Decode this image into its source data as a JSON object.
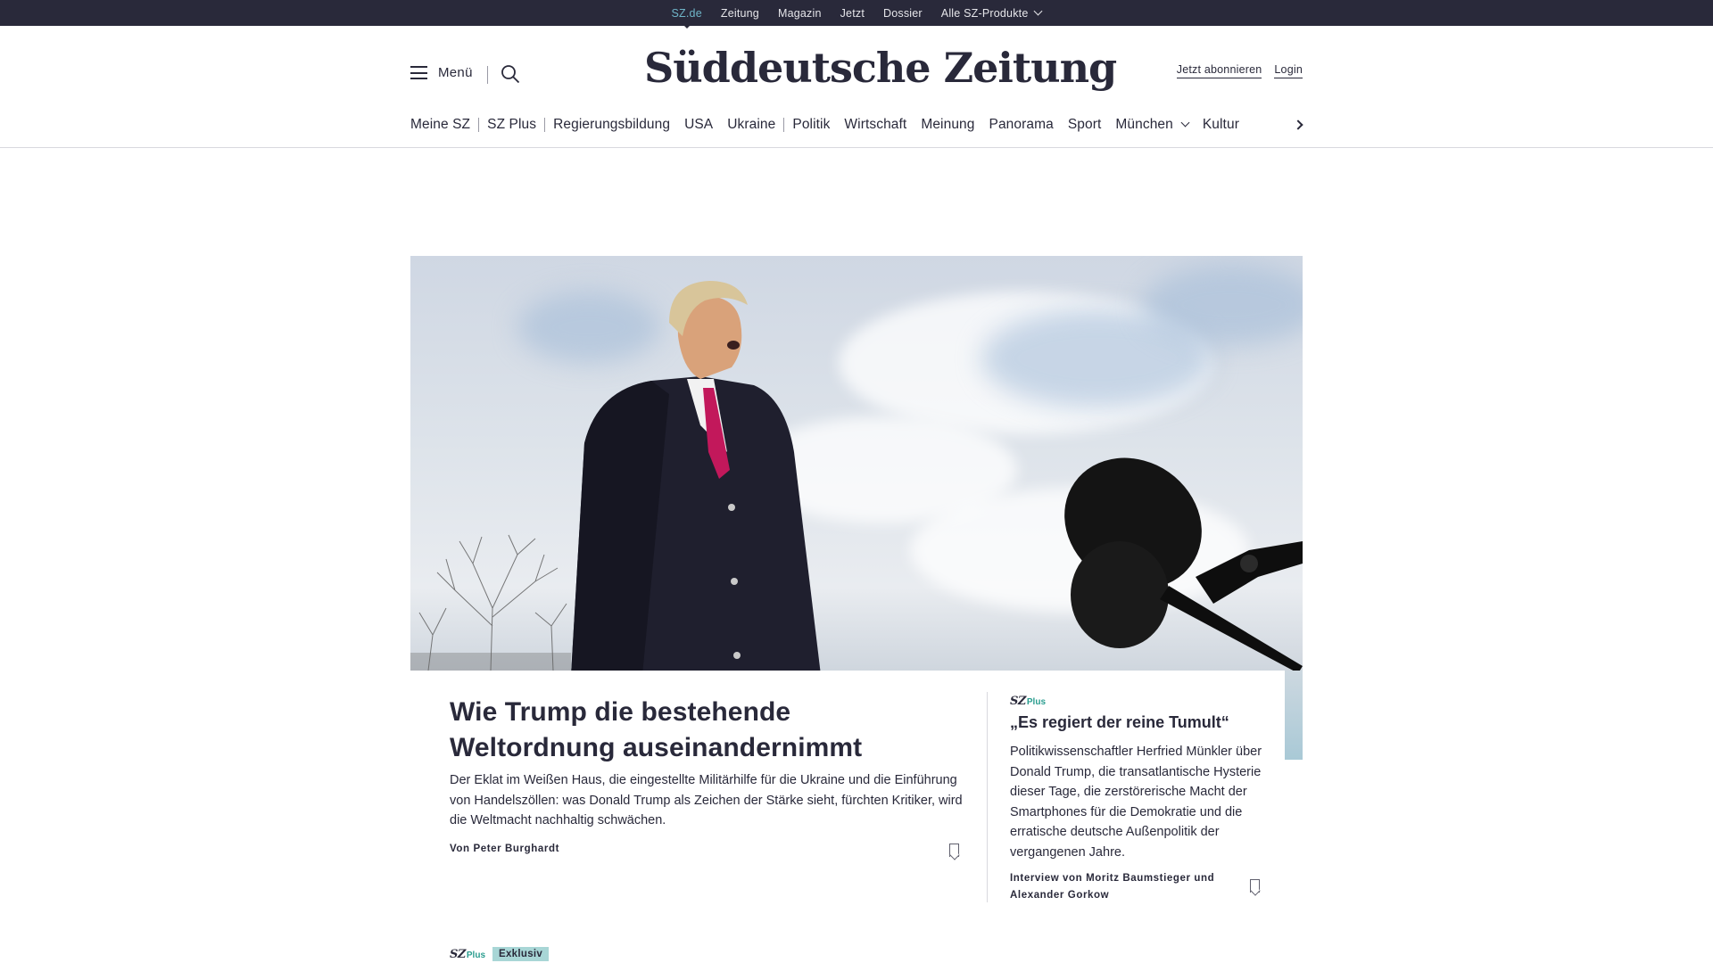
{
  "topnav": {
    "items": [
      "SZ.de",
      "Zeitung",
      "Magazin",
      "Jetzt",
      "Dossier",
      "Alle SZ-Produkte"
    ],
    "active": "SZ.de"
  },
  "header": {
    "menu_label": "Menü",
    "logo": "Süddeutsche Zeitung",
    "subscribe": "Jetzt abonnieren",
    "login": "Login"
  },
  "catnav": {
    "items": [
      "Meine SZ",
      "SZ Plus",
      "Regierungsbildung",
      "USA",
      "Ukraine",
      "Politik",
      "Wirtschaft",
      "Meinung",
      "Panorama",
      "Sport",
      "München",
      "Kultur"
    ]
  },
  "lead": {
    "title": "Wie Trump die bestehende Weltordnung auseinandernimmt",
    "teaser": "Der Eklat im Weißen Haus, die eingestellte Militärhilfe für die Ukraine und die Einführung von Handelszöllen: was Donald Trump als Zeichen der Stärke sieht, fürchten Kritiker, wird die Weltmacht nachhaltig schwächen.",
    "author": "Von Peter Burghardt"
  },
  "side": {
    "brand_sz": "SZ",
    "brand_plus": "Plus",
    "title": "„Es regiert der reine Tumult“",
    "teaser": "Politikwissenschaftler Herfried Münkler über Donald Trump, die transatlantische Hysterie dieser Tage, die zerstörerische Macht der Smartphones für die Demokratie und die erratische deutsche Außenpolitik der vergangenen Jahre.",
    "author": "Interview von Moritz Baumstieger und Alexander Gorkow"
  },
  "next": {
    "brand_sz": "SZ",
    "brand_plus": "Plus",
    "badge": "Exklusiv"
  },
  "colors": {
    "topbar": "#29293a",
    "active_link": "#6fb5c8",
    "plus_green": "#2a9d8f",
    "badge_bg": "#a8d6d6",
    "text": "#29293a"
  }
}
